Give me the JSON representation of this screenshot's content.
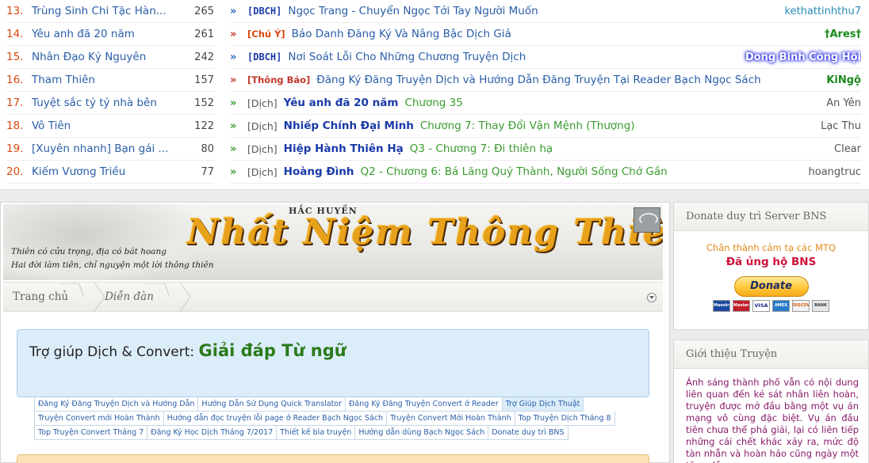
{
  "rankings": [
    {
      "num": "13.",
      "title": "Trùng Sinh Chi Tặc Hàn...",
      "count": "265"
    },
    {
      "num": "14.",
      "title": "Yêu anh đã 20 năm",
      "count": "261"
    },
    {
      "num": "15.",
      "title": "Nhân Đạo Kỷ Nguyên",
      "count": "242"
    },
    {
      "num": "16.",
      "title": "Tham Thiên",
      "count": "157"
    },
    {
      "num": "17.",
      "title": "Tuyệt sắc tỷ tỷ nhà bên",
      "count": "152"
    },
    {
      "num": "18.",
      "title": "Vô Tiên",
      "count": "122"
    },
    {
      "num": "19.",
      "title": "[Xuyên nhanh] Bạn gái ...",
      "count": "80"
    },
    {
      "num": "20.",
      "title": "Kiếm Vương Triều",
      "count": "77"
    }
  ],
  "threads": [
    {
      "arrow": "»",
      "prefix": "[DBCH]",
      "novel": "",
      "title": "Ngọc Trang - Chuyển Ngọc Tới Tay Người Muốn",
      "author": "kethattinhthu7"
    },
    {
      "arrow": "»",
      "prefix": "[Chú Ý]",
      "novel": "",
      "title": "Báo Danh Đăng Ký Và Nâng Bậc Dịch Giả",
      "author": "†Ares†"
    },
    {
      "arrow": "»",
      "prefix": "[DBCH]",
      "novel": "",
      "title": "Nơi Soát Lỗi Cho Những Chương Truyện Dịch",
      "author": "Dong Binh Công Hội"
    },
    {
      "arrow": "»",
      "prefix": "[Thông Báo]",
      "novel": "",
      "title": "Đăng Ký Đăng Truyện Dịch và Hướng Dẫn Đăng Truyện Tại Reader Bạch Ngọc Sách",
      "author": "KiNgộ"
    },
    {
      "arrow": "»",
      "prefix": "[Dịch]",
      "novel": "Yêu anh đã 20 năm",
      "title": "Chương 35",
      "author": "An Yên"
    },
    {
      "arrow": "»",
      "prefix": "[Dịch]",
      "novel": "Nhiếp Chính Đại Minh",
      "title": "Chương 7: Thay Đổi Vận Mệnh (Thượng)",
      "author": "Lạc Thu"
    },
    {
      "arrow": "»",
      "prefix": "[Dịch]",
      "novel": "Hiệp Hành Thiên Hạ",
      "title": "Q3 - Chương 7: Đi thiên hạ",
      "author": "Clear"
    },
    {
      "arrow": "»",
      "prefix": "[Dịch]",
      "novel": "Hoàng Đình",
      "title": "Q2 - Chương 6: Bá Lăng Quỷ Thành, Người Sống Chớ Gần",
      "author": "hoangtruc"
    }
  ],
  "banner": {
    "author": "HẮC HUYỀN",
    "title": "Nhất Niệm Thông Thiên",
    "poem_line1": "Thiên có cửu trọng, địa có bát hoang",
    "poem_line2": "Hai đời làm tiên, chỉ nguyện một lời thông thiên"
  },
  "breadcrumb": {
    "home": "Trang chủ",
    "forum": "Diễn đàn"
  },
  "page_title": {
    "prefix": "Trợ giúp Dịch & Convert:",
    "main": "Giải đáp Từ ngữ"
  },
  "quicklinks": [
    [
      "Đăng Ký Đăng Truyện Dịch và Hướng Dẫn",
      "Hướng Dẫn Sử Dụng Quick Translator",
      "Đăng Ký Đăng Truyện Convert ở Reader",
      "Trợ Giúp Dịch Thuật"
    ],
    [
      "Truyện Convert mới Hoàn Thành",
      "Hướng dẫn đọc truyện lỗi page ở Reader Bạch Ngọc Sách",
      "Truyện Convert Mới Hoàn Thành",
      "Top Truyện Dịch Tháng 8"
    ],
    [
      "Top Truyện Convert Tháng 7",
      "Đăng Ký Học Dịch Tháng 7/2017",
      "Thiết kế bìa truyện",
      "Hướng dẫn dùng Bạch Ngọc Sách",
      "Donate duy trì BNS"
    ]
  ],
  "sidebar": {
    "donate_header": "Donate duy trì Server BNS",
    "donate_thanks": "Chân thành cảm tạ các MTQ",
    "donate_done": "Đã ủng hộ BNS",
    "donate_button": "Donate",
    "cards": [
      "Maestro",
      "MasterCard",
      "VISA",
      "AMEX",
      "DISCOVER",
      "BANK"
    ],
    "intro_header": "Giới thiệu Truyện",
    "intro_text": "Ánh sáng thành phố vẫn có nội dung liên quan đến kẻ sát nhân liên hoàn, truyện được mở đầu bằng một vụ án mạng vô cùng đặc biệt. Vụ án đầu tiên chưa thể phá giải, lại có liên tiếp những cái chết khác xảy ra, mức độ tàn nhẫn và hoàn hảo cũng ngày một tăng dần."
  },
  "colors": {
    "link": "#2a5ea8",
    "accent_orange": "#d9480f",
    "title_green": "#2a7a1a",
    "title_box_bg": "#dcedfa"
  }
}
